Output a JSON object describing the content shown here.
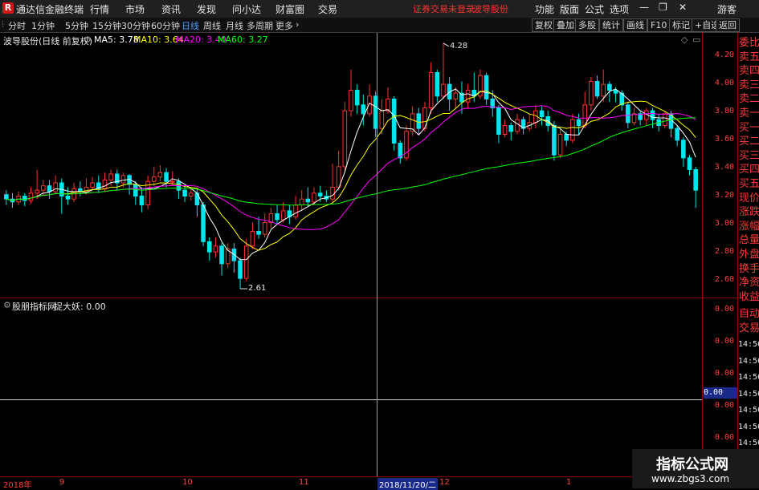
{
  "app": {
    "logo": "R",
    "title": "通达信金融终端"
  },
  "menu": [
    "行情",
    "市场",
    "资讯",
    "发现",
    "问小达",
    "财富圈",
    "交易"
  ],
  "status": {
    "login": "证券交易未登录",
    "stock": "波导股份"
  },
  "right_menu": [
    "功能",
    "版面",
    "公式",
    "选项"
  ],
  "user": "游客",
  "periods": [
    "分时",
    "1分钟",
    "5分钟",
    "15分钟",
    "30分钟",
    "60分钟",
    "日线",
    "周线",
    "月线",
    "多周期",
    "更多"
  ],
  "active_period": "日线",
  "right_buttons": [
    "复权",
    "叠加",
    "多股",
    "统计",
    "画线",
    "F10",
    "标记",
    "+自选",
    "返回"
  ],
  "main_chart": {
    "title": "波导股份(日线 前复权)",
    "ma": [
      {
        "label": "MA5: 3.78",
        "color": "#ffffff"
      },
      {
        "label": "MA10: 3.64",
        "color": "#ffff00"
      },
      {
        "label": "MA20: 3.40",
        "color": "#ff00ff"
      },
      {
        "label": "MA60: 3.27",
        "color": "#00ff00"
      }
    ],
    "high_label": "4.28",
    "low_label": "2.61"
  },
  "y_top_labels": [
    "4.20",
    "4.00",
    "3.80",
    "3.60",
    "3.40",
    "3.20",
    "3.00",
    "2.80",
    "2.60"
  ],
  "sub_chart": {
    "title": "股朋指标网",
    "indicator": "捉大妖: 0.00"
  },
  "y_bot_labels": [
    "0.00",
    "0.00",
    "0.00",
    "0.00",
    "0.00"
  ],
  "y_bot_current": "0.00",
  "side_labels": [
    "委比",
    "卖五",
    "卖四",
    "卖三",
    "卖二",
    "卖一",
    "买一",
    "买二",
    "买三",
    "买四",
    "买五",
    "现价",
    "涨跌",
    "涨幅",
    "总量",
    "外盘",
    "换手",
    "净资",
    "收益"
  ],
  "side_labels2": [
    "自动",
    "交易"
  ],
  "side_times": [
    "14:56",
    "14:56",
    "14:56",
    "14:56",
    "14:56",
    "14:56",
    "14:56",
    "14:56"
  ],
  "x_labels": [
    "2018年",
    "9",
    "10",
    "11",
    "12",
    "1"
  ],
  "cursor_date": "2018/11/20/二",
  "watermark": {
    "title": "指标公式网",
    "url": "www.zbgs3.com"
  },
  "chart_data": {
    "type": "candlestick",
    "ylim": [
      2.55,
      4.35
    ],
    "candles": [
      [
        3.25,
        3.22,
        3.28,
        3.18
      ],
      [
        3.22,
        3.2,
        3.26,
        3.16
      ],
      [
        3.2,
        3.24,
        3.27,
        3.18
      ],
      [
        3.24,
        3.21,
        3.26,
        3.17
      ],
      [
        3.21,
        3.26,
        3.3,
        3.19
      ],
      [
        3.26,
        3.28,
        3.42,
        3.22
      ],
      [
        3.28,
        3.31,
        3.35,
        3.24
      ],
      [
        3.31,
        3.27,
        3.35,
        3.22
      ],
      [
        3.27,
        3.33,
        3.38,
        3.25
      ],
      [
        3.33,
        3.24,
        3.36,
        3.12
      ],
      [
        3.24,
        3.22,
        3.3,
        3.18
      ],
      [
        3.22,
        3.29,
        3.33,
        3.2
      ],
      [
        3.29,
        3.27,
        3.34,
        3.24
      ],
      [
        3.27,
        3.3,
        3.36,
        3.25
      ],
      [
        3.3,
        3.33,
        3.37,
        3.28
      ],
      [
        3.33,
        3.29,
        3.38,
        3.26
      ],
      [
        3.29,
        3.35,
        3.4,
        3.27
      ],
      [
        3.35,
        3.39,
        3.42,
        3.31
      ],
      [
        3.39,
        3.33,
        3.42,
        3.28
      ],
      [
        3.33,
        3.38,
        3.4,
        3.3
      ],
      [
        3.38,
        3.32,
        3.39,
        3.25
      ],
      [
        3.32,
        3.24,
        3.34,
        3.18
      ],
      [
        3.24,
        3.18,
        3.3,
        3.13
      ],
      [
        3.18,
        3.34,
        3.38,
        3.15
      ],
      [
        3.34,
        3.37,
        3.44,
        3.31
      ],
      [
        3.37,
        3.4,
        3.45,
        3.34
      ],
      [
        3.4,
        3.34,
        3.43,
        3.3
      ],
      [
        3.34,
        3.34,
        3.41,
        3.31
      ],
      [
        3.34,
        3.28,
        3.36,
        3.22
      ],
      [
        3.28,
        3.24,
        3.31,
        3.2
      ],
      [
        3.24,
        3.26,
        3.3,
        3.21
      ],
      [
        3.26,
        3.18,
        3.29,
        3.1
      ],
      [
        3.18,
        2.93,
        3.2,
        2.9
      ],
      [
        2.93,
        2.86,
        2.96,
        2.8
      ],
      [
        2.86,
        2.9,
        2.96,
        2.82
      ],
      [
        2.9,
        2.78,
        2.92,
        2.7
      ],
      [
        2.78,
        2.88,
        2.92,
        2.75
      ],
      [
        2.88,
        2.8,
        2.92,
        2.72
      ],
      [
        2.8,
        2.68,
        2.82,
        2.61
      ],
      [
        2.68,
        2.9,
        2.95,
        2.66
      ],
      [
        2.9,
        3.0,
        3.06,
        2.88
      ],
      [
        3.0,
        2.98,
        3.1,
        2.95
      ],
      [
        2.98,
        3.06,
        3.12,
        2.96
      ],
      [
        3.06,
        3.12,
        3.16,
        3.02
      ],
      [
        3.12,
        3.08,
        3.18,
        3.05
      ],
      [
        3.08,
        3.14,
        3.2,
        3.06
      ],
      [
        3.14,
        3.1,
        3.18,
        3.05
      ],
      [
        3.1,
        3.18,
        3.24,
        3.08
      ],
      [
        3.18,
        3.22,
        3.28,
        3.14
      ],
      [
        3.22,
        3.2,
        3.3,
        3.17
      ],
      [
        3.2,
        3.26,
        3.3,
        3.18
      ],
      [
        3.26,
        3.24,
        3.31,
        3.2
      ],
      [
        3.24,
        3.22,
        3.28,
        3.2
      ],
      [
        3.22,
        3.3,
        3.46,
        3.2
      ],
      [
        3.3,
        3.44,
        3.55,
        3.28
      ],
      [
        3.44,
        3.82,
        3.88,
        3.4
      ],
      [
        3.82,
        3.96,
        4.1,
        3.78
      ],
      [
        3.96,
        3.86,
        4.0,
        3.8
      ],
      [
        3.86,
        3.8,
        3.93,
        3.72
      ],
      [
        3.8,
        3.92,
        4.0,
        3.78
      ],
      [
        3.92,
        3.7,
        3.95,
        3.64
      ],
      [
        3.7,
        3.82,
        3.9,
        3.66
      ],
      [
        3.82,
        3.9,
        3.98,
        3.8
      ],
      [
        3.9,
        3.6,
        3.92,
        3.55
      ],
      [
        3.6,
        3.5,
        3.62,
        3.46
      ],
      [
        3.5,
        3.68,
        3.72,
        3.48
      ],
      [
        3.68,
        3.8,
        3.85,
        3.65
      ],
      [
        3.8,
        3.7,
        3.84,
        3.66
      ],
      [
        3.7,
        3.84,
        3.88,
        3.68
      ],
      [
        3.84,
        4.08,
        4.15,
        3.8
      ],
      [
        4.08,
        3.92,
        4.1,
        3.88
      ],
      [
        3.92,
        4.0,
        4.28,
        3.9
      ],
      [
        4.0,
        3.9,
        4.05,
        3.82
      ],
      [
        3.9,
        3.94,
        3.98,
        3.84
      ],
      [
        3.94,
        3.88,
        4.02,
        3.8
      ],
      [
        3.88,
        3.96,
        4.0,
        3.84
      ],
      [
        3.96,
        3.92,
        4.08,
        3.88
      ],
      [
        3.92,
        4.06,
        4.1,
        3.9
      ],
      [
        4.06,
        3.9,
        4.08,
        3.86
      ],
      [
        3.9,
        3.84,
        3.96,
        3.78
      ],
      [
        3.84,
        3.66,
        3.86,
        3.6
      ],
      [
        3.66,
        3.72,
        3.76,
        3.64
      ],
      [
        3.72,
        3.68,
        3.74,
        3.62
      ],
      [
        3.68,
        3.76,
        3.8,
        3.66
      ],
      [
        3.76,
        3.7,
        3.78,
        3.66
      ],
      [
        3.7,
        3.74,
        3.8,
        3.68
      ],
      [
        3.74,
        3.82,
        3.86,
        3.7
      ],
      [
        3.82,
        3.78,
        3.85,
        3.72
      ],
      [
        3.78,
        3.72,
        3.82,
        3.68
      ],
      [
        3.72,
        3.52,
        3.75,
        3.48
      ],
      [
        3.52,
        3.66,
        3.7,
        3.5
      ],
      [
        3.66,
        3.62,
        3.68,
        3.58
      ],
      [
        3.62,
        3.76,
        3.8,
        3.6
      ],
      [
        3.76,
        3.72,
        3.8,
        3.66
      ],
      [
        3.72,
        3.86,
        3.95,
        3.7
      ],
      [
        3.86,
        4.02,
        4.05,
        3.82
      ],
      [
        4.02,
        3.92,
        4.06,
        3.9
      ],
      [
        3.92,
        4.0,
        4.1,
        3.88
      ],
      [
        4.0,
        3.96,
        4.02,
        3.88
      ],
      [
        3.96,
        3.94,
        3.98,
        3.88
      ],
      [
        3.94,
        3.86,
        3.96,
        3.82
      ],
      [
        3.86,
        3.74,
        3.88,
        3.7
      ],
      [
        3.74,
        3.8,
        3.84,
        3.72
      ],
      [
        3.8,
        3.76,
        3.82,
        3.72
      ],
      [
        3.76,
        3.82,
        3.84,
        3.72
      ],
      [
        3.82,
        3.76,
        3.84,
        3.7
      ],
      [
        3.76,
        3.72,
        3.8,
        3.68
      ],
      [
        3.72,
        3.8,
        3.82,
        3.7
      ],
      [
        3.8,
        3.7,
        3.82,
        3.64
      ],
      [
        3.7,
        3.62,
        3.72,
        3.58
      ],
      [
        3.62,
        3.5,
        3.64,
        3.44
      ],
      [
        3.5,
        3.42,
        3.52,
        3.38
      ],
      [
        3.42,
        3.28,
        3.44,
        3.16
      ]
    ]
  }
}
